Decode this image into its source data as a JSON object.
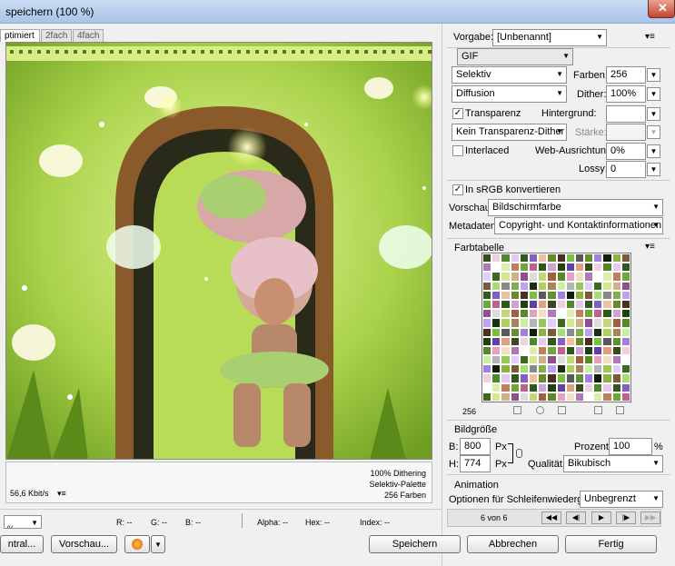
{
  "window": {
    "title": "speichern (100 %)",
    "close": "✕"
  },
  "tabs": [
    "ptimiert",
    "2fach",
    "4fach"
  ],
  "preview": {
    "info_lines": [
      "100% Dithering",
      "Selektiv-Palette",
      "256 Farben"
    ],
    "speed": "56,6 Kbit/s"
  },
  "status": {
    "zoom": "%",
    "r": "R: --",
    "g": "G: --",
    "b": "B: --",
    "alpha": "Alpha: --",
    "hex": "Hex: --",
    "index": "Index: --"
  },
  "left_buttons": {
    "zentral": "ntral...",
    "vorschau": "Vorschau..."
  },
  "panel": {
    "vorgabe_label": "Vorgabe:",
    "vorgabe_value": "[Unbenannt]",
    "format": "GIF",
    "reduction": "Selektiv",
    "farben_label": "Farben:",
    "farben_value": "256",
    "dither_algo": "Diffusion",
    "dither_label": "Dither:",
    "dither_value": "100%",
    "transparenz_label": "Transparenz",
    "transparenz_checked": true,
    "hintergrund_label": "Hintergrund:",
    "trans_dither": "Kein Transparenz-Dither",
    "staerke_label": "Stärke:",
    "interlaced_label": "Interlaced",
    "interlaced_checked": false,
    "web_label": "Web-Ausrichtung:",
    "web_value": "0%",
    "lossy_label": "Lossy:",
    "lossy_value": "0",
    "srgb_label": "In sRGB konvertieren",
    "srgb_checked": true,
    "vorschau_label": "Vorschau:",
    "vorschau_value": "Bildschirmfarbe",
    "metadaten_label": "Metadaten:",
    "metadaten_value": "Copyright- und Kontaktinformationen",
    "farbtabelle_label": "Farbtabelle",
    "farbtabelle_count": "256",
    "bildgroesse_label": "Bildgröße",
    "b_label": "B:",
    "b_value": "800",
    "h_label": "H:",
    "h_value": "774",
    "px": "Px",
    "prozent_label": "Prozent:",
    "prozent_value": "100",
    "percent": "%",
    "qualitaet_label": "Qualität:",
    "qualitaet_value": "Bikubisch",
    "animation_label": "Animation",
    "schleife_label": "Optionen für Schleifenwiedergabe:",
    "schleife_value": "Unbegrenzt",
    "frame": "6 von 6"
  },
  "footer": {
    "speichern": "Speichern",
    "abbrechen": "Abbrechen",
    "fertig": "Fertig"
  },
  "palette": [
    "#3a4a1a",
    "#6a8a2a",
    "#8cb43c",
    "#b0d060",
    "#d4e890",
    "#e8a0c0",
    "#c06090",
    "#f0d0e0",
    "#4a3020",
    "#7a5a3a",
    "#a8845a",
    "#d0b088",
    "#f0e0c0",
    "#2a5a1a",
    "#4a8a2a",
    "#78c040",
    "#a4e070",
    "#c8f0a0",
    "#905090",
    "#b078b8",
    "#d0a0d8",
    "#e8c8f0",
    "#5a5a5a",
    "#8a8a8a",
    "#b4b4b4",
    "#dcdcdc",
    "#ffffff",
    "#204010",
    "#305820",
    "#609030",
    "#80b048",
    "#98c858",
    "#c0d878",
    "#ddeeaa",
    "#6040a0",
    "#8060c0",
    "#a080e0",
    "#c0a0f0",
    "#e0d0ff",
    "#a06040",
    "#c08060",
    "#e0a080",
    "#f0c0a0",
    "#102008",
    "#1a3010",
    "#406820",
    "#5a8828",
    "#70a838"
  ]
}
